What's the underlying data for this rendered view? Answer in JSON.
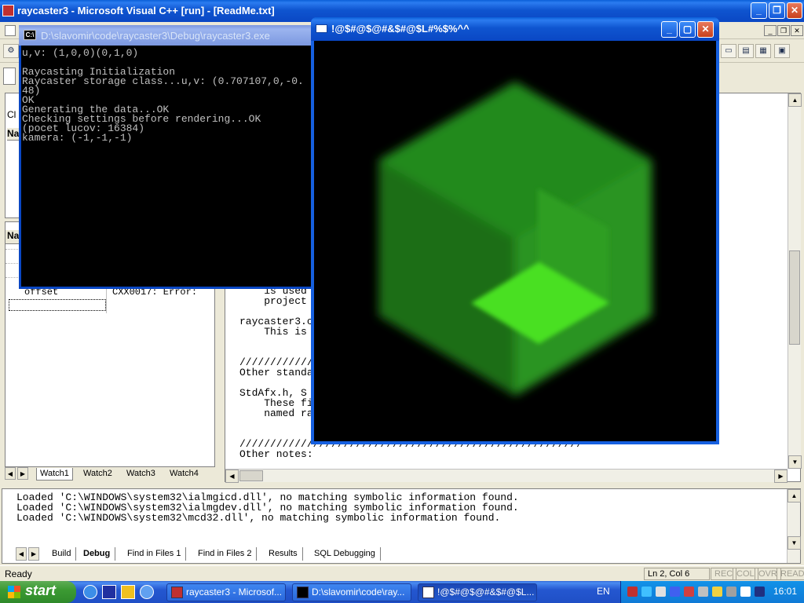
{
  "vc_window": {
    "title": "raycaster3 - Microsoft Visual C++ [run] - [ReadMe.txt]"
  },
  "left_top_pane": {
    "labels": [
      "Cl",
      "Na"
    ]
  },
  "watch": {
    "header": "Na",
    "rows": [
      {
        "name": "offset",
        "value": "CXX0017: Error:"
      }
    ],
    "tabs": [
      "Watch1",
      "Watch2",
      "Watch3",
      "Watch4"
    ]
  },
  "editor": {
    "lines": [
      "                                                     nd",
      "    is used                                           he",
      "    project",
      "",
      "raycaster3.c",
      "    This is",
      "",
      "////////////////////////////////////////////////////////",
      "Other standa",
      "",
      "StdAfx.h, S",
      "    These fi",
      "    named ra",
      "",
      "////////////////////////////////////////////////////////",
      "Other notes:"
    ]
  },
  "output": {
    "lines": [
      "Loaded 'C:\\WINDOWS\\system32\\ialmgicd.dll', no matching symbolic information found.",
      "Loaded 'C:\\WINDOWS\\system32\\ialmgdev.dll', no matching symbolic information found.",
      "Loaded 'C:\\WINDOWS\\system32\\mcd32.dll', no matching symbolic information found."
    ],
    "tabs": [
      "Build",
      "Debug",
      "Find in Files 1",
      "Find in Files 2",
      "Results",
      "SQL Debugging"
    ]
  },
  "status": {
    "text": "Ready",
    "position": "Ln 2, Col 6",
    "indicators": [
      "REC",
      "COL",
      "OVR",
      "READ"
    ]
  },
  "console": {
    "title": "D:\\slavomir\\code\\raycaster3\\Debug\\raycaster3.exe",
    "lines": [
      "u,v: (1,0,0)(0,1,0)",
      "",
      "Raycasting Initialization",
      "Raycaster storage class...u,v: (0.707107,0,-0.",
      "48)",
      "OK",
      "Generating the data...OK",
      "Checking settings before rendering...OK",
      "(pocet lucov: 16384)",
      "kamera: (-1,-1,-1)"
    ]
  },
  "gl_window": {
    "title": "!@$#@$@#&$#@$L#%$%^^"
  },
  "taskbar": {
    "start_label": "start",
    "tasks": [
      "raycaster3 - Microsof...",
      "D:\\slavomir\\code\\ray...",
      "!@$#@$@#&$#@$L..."
    ],
    "language": "EN",
    "clock": "16:01"
  },
  "colors": {
    "cube_green": "#22b622",
    "cube_highlight": "#44ee22",
    "xp_blue": "#0a47c4"
  }
}
